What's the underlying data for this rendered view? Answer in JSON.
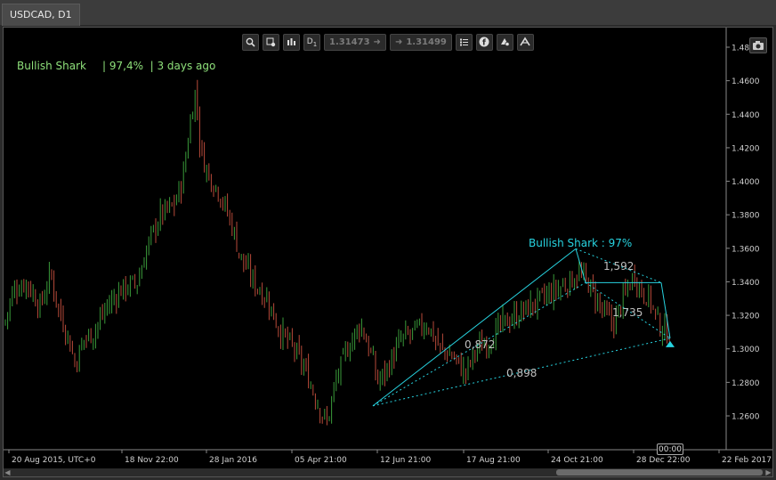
{
  "window": {
    "tab_label": "USDCAD, D1"
  },
  "toolbar": {
    "timeframe_label": "D",
    "timeframe_sub": "1",
    "bid": "1.31473",
    "ask": "1.31499",
    "icons": [
      "zoom-icon",
      "crosshair-settings-icon",
      "bar-chart-icon",
      "timeframe-icon",
      "arrow-right-icon",
      "arrow-right-icon",
      "list-icon",
      "facebook-icon",
      "alert-icon",
      "indicator-icon"
    ]
  },
  "overlay": {
    "pattern_name": "Bullish Shark",
    "pattern_stats": "| 97,4%  | 3 days ago",
    "pattern_label": "Bullish Shark : 97%",
    "ratios": [
      "0,872",
      "0,898",
      "1,592",
      "1,735"
    ],
    "time_flag": "00:00",
    "colors": {
      "header_text": "#8ee07a",
      "pattern": "#27d3e0",
      "ratio_text": "#bfbfbf",
      "bull": "#3a9a3a",
      "bear": "#b84a3a"
    }
  },
  "chart_data": {
    "type": "candlestick",
    "symbol": "USDCAD",
    "timeframe": "D1",
    "ylim": [
      1.24,
      1.49
    ],
    "yticks": [
      "1.4800",
      "1.4600",
      "1.4400",
      "1.4200",
      "1.4000",
      "1.3800",
      "1.3600",
      "1.3400",
      "1.3200",
      "1.3000",
      "1.2800",
      "1.2600"
    ],
    "xticks": [
      "20 Aug 2015, UTC+0",
      "18 Nov 22:00",
      "28 Jan 2016",
      "05 Apr 21:00",
      "12 Jun 21:00",
      "17 Aug 21:00",
      "24 Oct 21:00",
      "28 Dec 22:00",
      "22 Feb 2017"
    ],
    "price_path": [
      [
        0,
        1.315
      ],
      [
        10,
        1.335
      ],
      [
        25,
        1.34
      ],
      [
        40,
        1.325
      ],
      [
        52,
        1.345
      ],
      [
        60,
        1.325
      ],
      [
        70,
        1.31
      ],
      [
        80,
        1.29
      ],
      [
        88,
        1.305
      ],
      [
        100,
        1.31
      ],
      [
        115,
        1.325
      ],
      [
        130,
        1.335
      ],
      [
        150,
        1.34
      ],
      [
        160,
        1.36
      ],
      [
        175,
        1.38
      ],
      [
        190,
        1.385
      ],
      [
        200,
        1.4
      ],
      [
        210,
        1.44
      ],
      [
        215,
        1.455
      ],
      [
        220,
        1.42
      ],
      [
        228,
        1.405
      ],
      [
        240,
        1.395
      ],
      [
        255,
        1.375
      ],
      [
        265,
        1.355
      ],
      [
        280,
        1.34
      ],
      [
        295,
        1.33
      ],
      [
        310,
        1.31
      ],
      [
        325,
        1.3
      ],
      [
        340,
        1.285
      ],
      [
        350,
        1.27
      ],
      [
        362,
        1.255
      ],
      [
        372,
        1.28
      ],
      [
        385,
        1.3
      ],
      [
        400,
        1.315
      ],
      [
        410,
        1.3
      ],
      [
        420,
        1.28
      ],
      [
        432,
        1.29
      ],
      [
        445,
        1.305
      ],
      [
        460,
        1.31
      ],
      [
        475,
        1.315
      ],
      [
        490,
        1.3
      ],
      [
        505,
        1.295
      ],
      [
        518,
        1.285
      ],
      [
        530,
        1.3
      ],
      [
        545,
        1.305
      ],
      [
        560,
        1.315
      ],
      [
        575,
        1.32
      ],
      [
        590,
        1.325
      ],
      [
        605,
        1.33
      ],
      [
        620,
        1.335
      ],
      [
        635,
        1.34
      ],
      [
        645,
        1.345
      ],
      [
        655,
        1.34
      ],
      [
        665,
        1.33
      ],
      [
        675,
        1.32
      ],
      [
        685,
        1.315
      ],
      [
        695,
        1.33
      ],
      [
        708,
        1.345
      ],
      [
        715,
        1.335
      ],
      [
        725,
        1.33
      ],
      [
        735,
        1.315
      ],
      [
        742,
        1.31
      ],
      [
        748,
        1.31
      ]
    ],
    "pattern_points": {
      "X": [
        418,
        1.266
      ],
      "A": [
        646,
        1.3597
      ],
      "B": [
        657,
        1.3395
      ],
      "C": [
        742,
        1.3395
      ],
      "D": [
        752,
        1.3063
      ]
    }
  }
}
